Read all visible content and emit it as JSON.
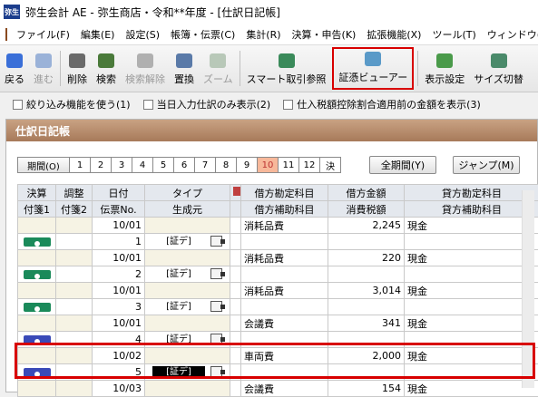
{
  "title_bar": {
    "app_icon_text": "弥生",
    "title": "弥生会計 AE - 弥生商店・令和**年度 - [仕訳日記帳]"
  },
  "menu": [
    "ファイル(F)",
    "編集(E)",
    "設定(S)",
    "帳簿・伝票(C)",
    "集計(R)",
    "決算・申告(K)",
    "拡張機能(X)",
    "ツール(T)",
    "ウィンドウ(W)"
  ],
  "toolbar": [
    {
      "label": "戻る",
      "icon": "back-arrow-icon",
      "color": "#3a6fd8",
      "enabled": true
    },
    {
      "label": "進む",
      "icon": "forward-arrow-icon",
      "color": "#9ab2d8",
      "enabled": false
    },
    {
      "label": "削除",
      "icon": "trash-icon",
      "color": "#6a6a6a",
      "enabled": true
    },
    {
      "label": "検索",
      "icon": "search-icon",
      "color": "#4a7a3a",
      "enabled": true
    },
    {
      "label": "検索解除",
      "icon": "search-clear-icon",
      "color": "#b0b0b0",
      "enabled": false
    },
    {
      "label": "置換",
      "icon": "replace-icon",
      "color": "#5a7aa8",
      "enabled": true
    },
    {
      "label": "ズーム",
      "icon": "zoom-icon",
      "color": "#b8c8b8",
      "enabled": false
    },
    {
      "label": "スマート取引参照",
      "icon": "smart-transaction-icon",
      "color": "#3a8a5a",
      "enabled": true
    },
    {
      "label": "証憑ビューアー",
      "icon": "voucher-viewer-icon",
      "color": "#5a9ac8",
      "enabled": true,
      "highlighted": true
    },
    {
      "label": "表示設定",
      "icon": "display-settings-icon",
      "color": "#4a9a4a",
      "enabled": true
    },
    {
      "label": "サイズ切替",
      "icon": "size-switch-icon",
      "color": "#4a8a6a",
      "enabled": true
    }
  ],
  "options": [
    "絞り込み機能を使う(1)",
    "当日入力仕訳のみ表示(2)",
    "仕入税額控除割合適用前の金額を表示(3)"
  ],
  "panel_title": "仕訳日記帳",
  "period": {
    "label": "期間(O)",
    "months": [
      "1",
      "2",
      "3",
      "4",
      "5",
      "6",
      "7",
      "8",
      "9",
      "10",
      "11",
      "12",
      "決"
    ],
    "selected": "10",
    "full_period_label": "全期間(Y)",
    "jump_label": "ジャンプ(M)"
  },
  "columns": {
    "row1": [
      "決算",
      "調整",
      "日付",
      "タイプ",
      "",
      "借方勘定科目",
      "借方金額",
      "貸方勘定科目"
    ],
    "row2": [
      "付箋1",
      "付箋2",
      "伝票No.",
      "生成元",
      "",
      "借方補助科目",
      "消費税額",
      "貸方補助科目"
    ]
  },
  "entries": [
    {
      "date": "10/01",
      "no": "1",
      "type": "[証デ]",
      "debit_account": "消耗品費",
      "debit_amount": "2,245",
      "credit_account": "現金",
      "fusen_color": "#1a8a5a",
      "selected": false
    },
    {
      "date": "10/01",
      "no": "2",
      "type": "[証デ]",
      "debit_account": "消耗品費",
      "debit_amount": "220",
      "credit_account": "現金",
      "fusen_color": "#1a8a5a",
      "selected": false
    },
    {
      "date": "10/01",
      "no": "3",
      "type": "[証デ]",
      "debit_account": "消耗品費",
      "debit_amount": "3,014",
      "credit_account": "現金",
      "fusen_color": "#1a8a5a",
      "selected": false
    },
    {
      "date": "10/01",
      "no": "4",
      "type": "[証デ]",
      "debit_account": "会議費",
      "debit_amount": "341",
      "credit_account": "現金",
      "fusen_color": "#3a4ab8",
      "selected": false
    },
    {
      "date": "10/02",
      "no": "5",
      "type": "[証デ]",
      "debit_account": "車両費",
      "debit_amount": "2,000",
      "credit_account": "現金",
      "fusen_color": "#3a4ab8",
      "selected": true
    },
    {
      "date": "10/03",
      "no": "",
      "type": "",
      "debit_account": "会議費",
      "debit_amount": "154",
      "credit_account": "現金",
      "fusen_color": "",
      "selected": false
    }
  ]
}
